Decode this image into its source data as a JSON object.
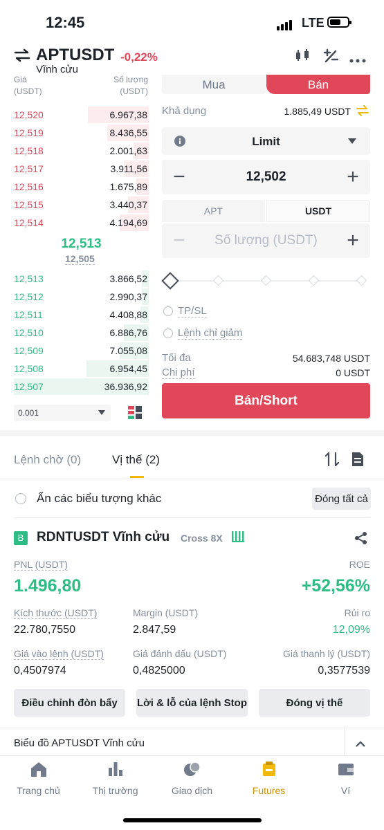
{
  "status": {
    "time": "12:45",
    "network": "LTE"
  },
  "header": {
    "symbol": "APTUSDT",
    "change": "-0,22%",
    "subtitle": "Vĩnh cửu"
  },
  "orderbook": {
    "col_price": "Giá",
    "col_price_unit": "(USDT)",
    "col_qty": "Số lượng",
    "col_qty_unit": "(USDT)",
    "asks": [
      {
        "price": "12,520",
        "qty": "6.967,38"
      },
      {
        "price": "12,519",
        "qty": "8.436,55"
      },
      {
        "price": "12,518",
        "qty": "2.001,63"
      },
      {
        "price": "12,517",
        "qty": "3.911,56"
      },
      {
        "price": "12,516",
        "qty": "1.675,89"
      },
      {
        "price": "12,515",
        "qty": "3.440,37"
      },
      {
        "price": "12,514",
        "qty": "4.194,69"
      }
    ],
    "mid_price": "12,513",
    "mark_price": "12,505",
    "bids": [
      {
        "price": "12,513",
        "qty": "3.866,52"
      },
      {
        "price": "12,512",
        "qty": "2.990,37"
      },
      {
        "price": "12,511",
        "qty": "4.408,88"
      },
      {
        "price": "12,510",
        "qty": "6.886,76"
      },
      {
        "price": "12,509",
        "qty": "7.055,08"
      },
      {
        "price": "12,508",
        "qty": "6.954,45"
      },
      {
        "price": "12,507",
        "qty": "36.936,92"
      }
    ],
    "precision": "0.001"
  },
  "form": {
    "buy_tab": "Mua",
    "sell_tab": "Bán",
    "available_label": "Khả dụng",
    "available_value": "1.885,49 USDT",
    "order_type": "Limit",
    "price": "12,502",
    "unit_a": "APT",
    "unit_b": "USDT",
    "qty_placeholder": "Số lượng (USDT)",
    "tpsl": "TP/SL",
    "reduce_only": "Lệnh chỉ giảm",
    "max_label": "Tối đa",
    "max_value": "54.683,748 USDT",
    "cost_label": "Chi phí",
    "cost_value": "0 USDT",
    "submit": "Bán/Short"
  },
  "tabs": {
    "open_orders": "Lệnh chờ (0)",
    "positions": "Vị thế (2)"
  },
  "hide_symbols": "Ẩn các biểu tượng khác",
  "close_all": "Đóng tất cả",
  "position": {
    "badge": "B",
    "symbol": "RDNTUSDT Vĩnh cửu",
    "mode": "Cross 8X",
    "pnl_label": "PNL (USDT)",
    "pnl_value": "1.496,80",
    "roe_label": "ROE",
    "roe_value": "+52,56%",
    "size_label": "Kích thước (USDT)",
    "size_value": "22.780,7550",
    "margin_label": "Margin (USDT)",
    "margin_value": "2.847,59",
    "risk_label": "Rủi ro",
    "risk_value": "12,09%",
    "entry_label": "Giá vào lệnh (USDT)",
    "entry_value": "0,4507974",
    "mark_label": "Giá đánh dấu (USDT)",
    "mark_value": "0,4825000",
    "liq_label": "Giá thanh lý (USDT)",
    "liq_value": "0,3577539",
    "btn_leverage": "Điều chỉnh đòn bẩy",
    "btn_tpsl": "Lời & lỗ của lệnh Stop",
    "btn_close": "Đóng vị thế"
  },
  "chart_bar": "Biểu đồ APTUSDT Vĩnh cửu",
  "nav": {
    "home": "Trang chủ",
    "markets": "Thị trường",
    "trade": "Giao dịch",
    "futures": "Futures",
    "wallet": "Ví"
  },
  "colors": {
    "sell": "#e0485a",
    "buy": "#2ebd85",
    "accent": "#f0b90b"
  }
}
